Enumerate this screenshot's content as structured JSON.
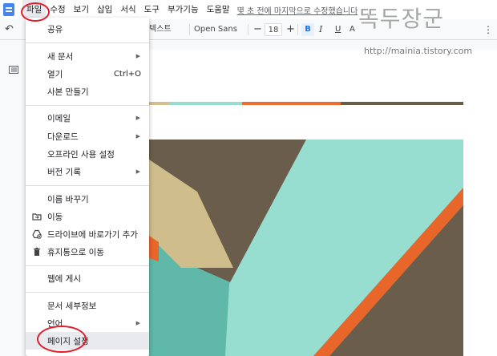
{
  "menubar": {
    "items": [
      "파일",
      "수정",
      "보기",
      "삽입",
      "서식",
      "도구",
      "부가기능",
      "도움말"
    ],
    "last_edit": "몇 초 전에 마지막으로 수정했습니다"
  },
  "toolbar": {
    "style_text": "텍스트",
    "font": "Open Sans",
    "font_size": "18",
    "bold": "B",
    "italic": "I",
    "underline": "U",
    "text_color": "A"
  },
  "file_menu": {
    "items": [
      {
        "label": "공유"
      },
      {
        "label": "새 문서",
        "submenu": true
      },
      {
        "label": "열기",
        "shortcut": "Ctrl+O"
      },
      {
        "label": "사본 만들기"
      },
      {
        "label": "이메일",
        "submenu": true
      },
      {
        "label": "다운로드",
        "submenu": true
      },
      {
        "label": "오프라인 사용 설정"
      },
      {
        "label": "버전 기록",
        "submenu": true
      },
      {
        "label": "이름 바꾸기"
      },
      {
        "label": "이동",
        "icon": "folder-move-icon"
      },
      {
        "label": "드라이브에 바로가기 추가",
        "icon": "drive-shortcut-icon"
      },
      {
        "label": "휴지통으로 이동",
        "icon": "trash-icon"
      },
      {
        "label": "웹에 게시"
      },
      {
        "label": "문서 세부정보"
      },
      {
        "label": "언어",
        "submenu": true
      },
      {
        "label": "페이지 설정",
        "highlighted": true
      }
    ]
  },
  "watermark": {
    "title": "똑두장군",
    "url": "http://mainia.tistory.com"
  },
  "colors": {
    "accent_blue": "#1a73e8",
    "annotation_red": "#e11d2a",
    "strip": [
      "#d2c08f",
      "#96ddd0",
      "#ec6b2d",
      "#6a5d48"
    ],
    "image_teal": "#5fb8a8",
    "image_mint": "#97ddd0",
    "image_tan": "#cfbd8c",
    "image_brown": "#6a5d4b",
    "image_orange": "#e8662a"
  }
}
